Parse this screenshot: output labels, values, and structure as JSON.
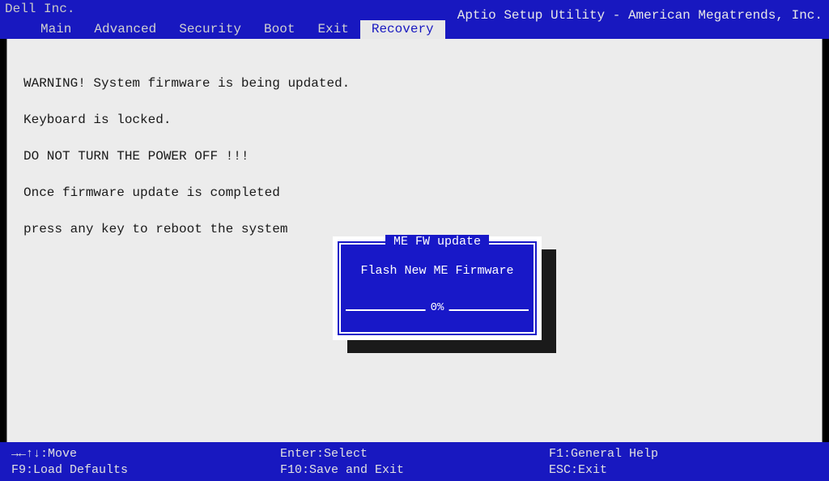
{
  "vendor": "Dell Inc.",
  "utility_title": "Aptio Setup Utility - American Megatrends, Inc.",
  "tabs": {
    "main": "Main",
    "advanced": "Advanced",
    "security": "Security",
    "boot": "Boot",
    "exit": "Exit",
    "recovery": "Recovery"
  },
  "active_tab": "Recovery",
  "warning": {
    "line1": "WARNING! System firmware is being updated.",
    "line2": "Keyboard is locked.",
    "line3": "DO NOT TURN THE POWER OFF !!!",
    "line4": "Once firmware update is completed",
    "line5": "press any key to reboot the system"
  },
  "dialog": {
    "title": "ME FW update",
    "body": "Flash New ME Firmware",
    "progress_label": "0%"
  },
  "footer": {
    "move": "→←↑↓:Move",
    "select": "Enter:Select",
    "help": "F1:General Help",
    "defaults": "F9:Load Defaults",
    "saveexit": "F10:Save and Exit",
    "esc": "ESC:Exit"
  },
  "colors": {
    "bios_blue": "#1818c0",
    "dialog_blue": "#1818c8",
    "panel_gray": "#ececec"
  }
}
